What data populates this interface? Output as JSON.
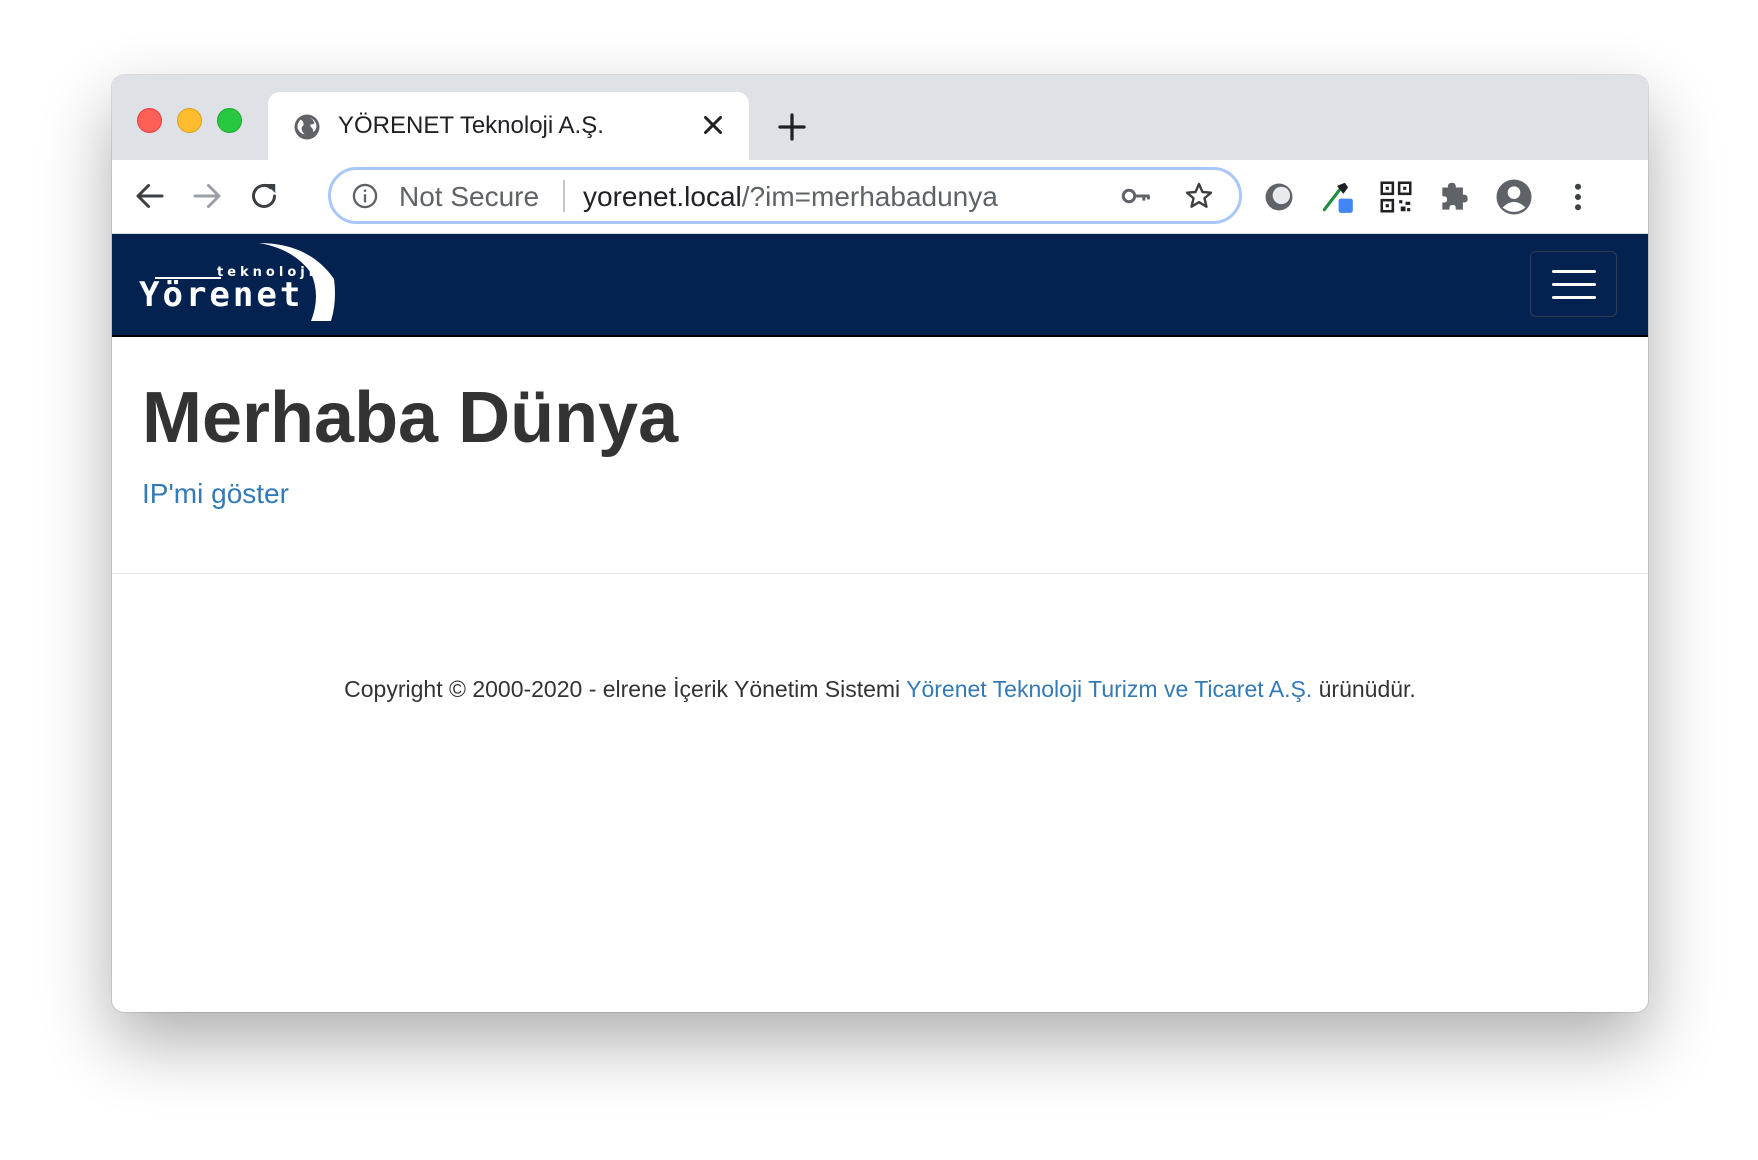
{
  "browser": {
    "tab": {
      "title": "YÖRENET Teknoloji A.Ş."
    },
    "omnibox": {
      "security_label": "Not Secure",
      "url_host": "yorenet.local",
      "url_rest": "/?im=merhabadunya"
    },
    "icons": {
      "back": "arrow-left-icon",
      "forward": "arrow-right-icon",
      "reload": "reload-icon",
      "info": "info-icon",
      "key": "key-icon",
      "bookmark": "star-icon",
      "extensions": [
        "circle-extension-icon",
        "eyedropper-extension-icon",
        "qr-code-extension-icon",
        "puzzle-icon"
      ],
      "profile": "account-icon",
      "menu": "more-vert-icon"
    }
  },
  "site": {
    "logo": {
      "small": "teknoloji",
      "main": "Yörenet"
    },
    "heading": "Merhaba Dünya",
    "ip_link": "IP'mi göster",
    "footer": {
      "prefix": "Copyright © 2000-2020 - elrene İçerik Yönetim Sistemi ",
      "link": "Yörenet Teknoloji Turizm ve Ticaret A.Ş.",
      "suffix": " ürünüdür."
    },
    "colors": {
      "navbar": "#03224f",
      "link": "#337ab7",
      "text": "#333333"
    }
  }
}
